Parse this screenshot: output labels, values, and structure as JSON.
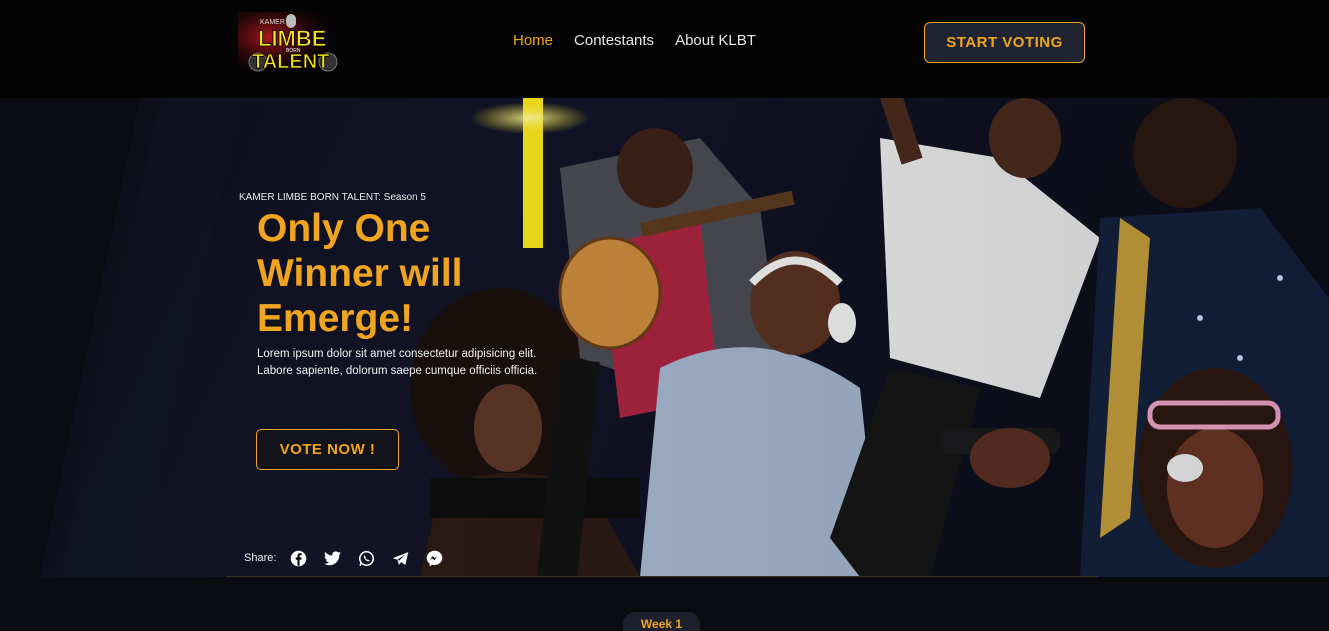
{
  "header": {
    "logo": {
      "line_small": "KAMER",
      "line1": "LIMBE",
      "line_mid": "BORN",
      "line2": "TALENT"
    },
    "nav": [
      {
        "label": "Home",
        "active": true
      },
      {
        "label": "Contestants",
        "active": false
      },
      {
        "label": "About KLBT",
        "active": false
      }
    ],
    "cta_label": "START VOTING"
  },
  "hero": {
    "eyebrow": "KAMER LIMBE BORN TALENT: Season 5",
    "headline": "Only One Winner will Emerge!",
    "lede": "Lorem ipsum dolor sit amet consectetur adipisicing elit. Labore sapiente, dolorum saepe cumque officiis officia.",
    "vote_label": "VOTE NOW !",
    "share": {
      "label": "Share:",
      "icons": [
        "facebook-icon",
        "twitter-icon",
        "whatsapp-icon",
        "telegram-icon",
        "messenger-icon"
      ]
    }
  },
  "week_tab": "Week 1",
  "colors": {
    "accent": "#f0a521",
    "background": "#040404",
    "button_fill": "#1f2430"
  }
}
